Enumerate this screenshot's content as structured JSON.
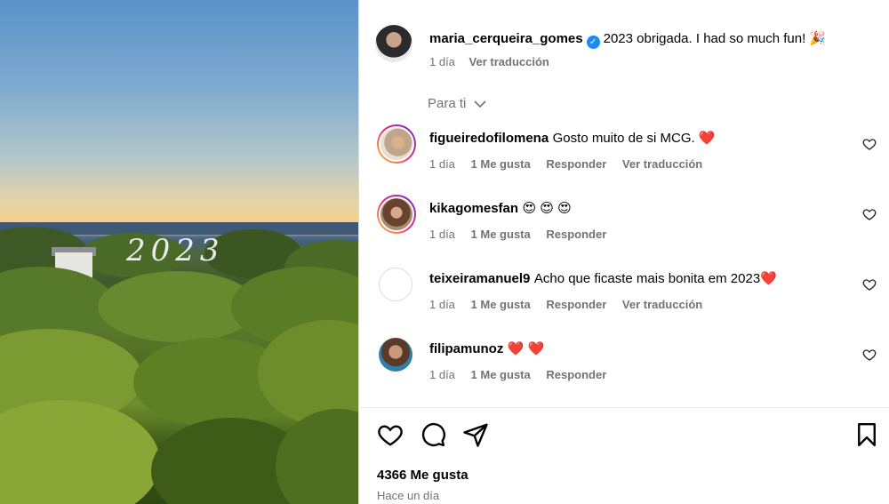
{
  "media": {
    "overlay_text": "2023"
  },
  "post": {
    "author": "maria_cerqueira_gomes",
    "caption": "2023 obrigada. I had so much fun! 🎉",
    "age": "1 día",
    "translate": "Ver traducción"
  },
  "filter": {
    "label": "Para ti"
  },
  "comments": [
    {
      "user": "figueiredofilomena",
      "text": "Gosto muito de si MCG. ❤️",
      "age": "1 día",
      "likes": "1 Me gusta",
      "reply": "Responder",
      "translate": "Ver traducción"
    },
    {
      "user": "kikagomesfan",
      "text": "😍 😍 😍",
      "age": "1 día",
      "likes": "1 Me gusta",
      "reply": "Responder",
      "translate": ""
    },
    {
      "user": "teixeiramanuel9",
      "text": "Acho que ficaste mais bonita em 2023❤️",
      "age": "1 día",
      "likes": "1 Me gusta",
      "reply": "Responder",
      "translate": "Ver traducción"
    },
    {
      "user": "filipamunoz",
      "text": "❤️ ❤️",
      "age": "1 día",
      "likes": "1 Me gusta",
      "reply": "Responder",
      "translate": ""
    }
  ],
  "footer": {
    "likes": "4366 Me gusta",
    "time": "Hace un día"
  },
  "colors": {
    "verified": "#1a8cf0",
    "muted_text": "#737373",
    "heart_red": "#e0245e"
  }
}
